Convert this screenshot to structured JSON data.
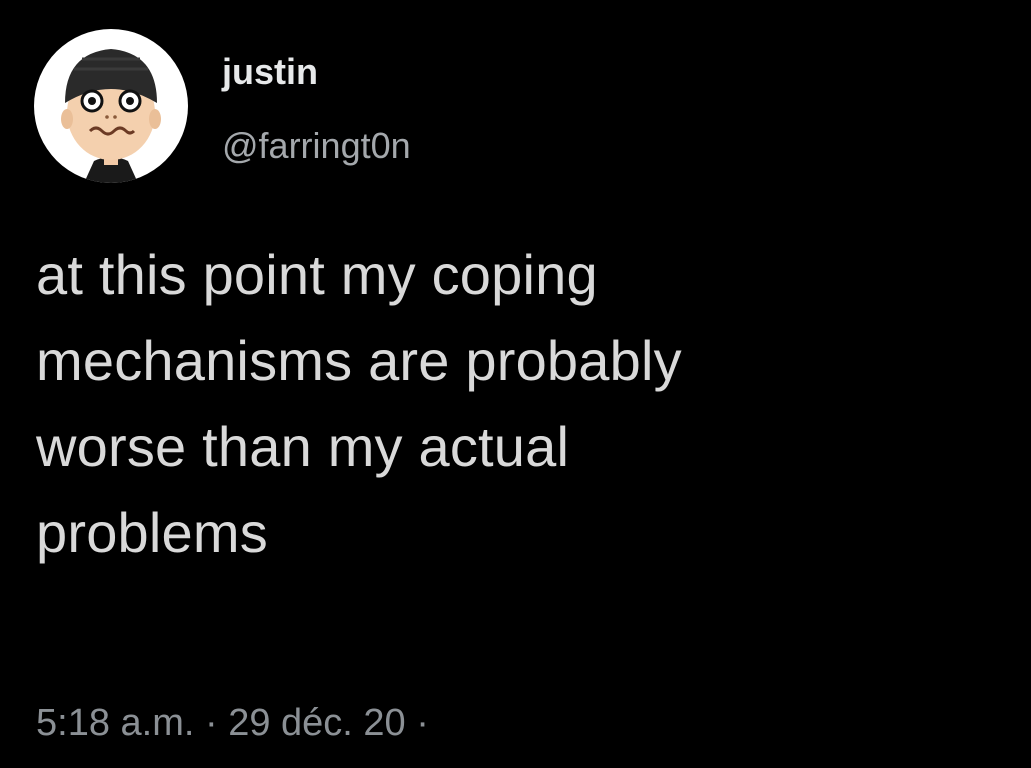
{
  "author": {
    "display_name": "justin",
    "handle": "@farringt0n",
    "avatar_icon": "mii-avatar-icon"
  },
  "tweet": {
    "lines": [
      "at this point my coping",
      "mechanisms are probably",
      "worse than my actual",
      "problems"
    ]
  },
  "meta": {
    "time": "5:18 a.m.",
    "separator": "·",
    "date": "29 déc. 20",
    "trailing": "·"
  },
  "colors": {
    "background": "#000000",
    "text": "#d9d9d9",
    "secondary": "#8b9095"
  }
}
